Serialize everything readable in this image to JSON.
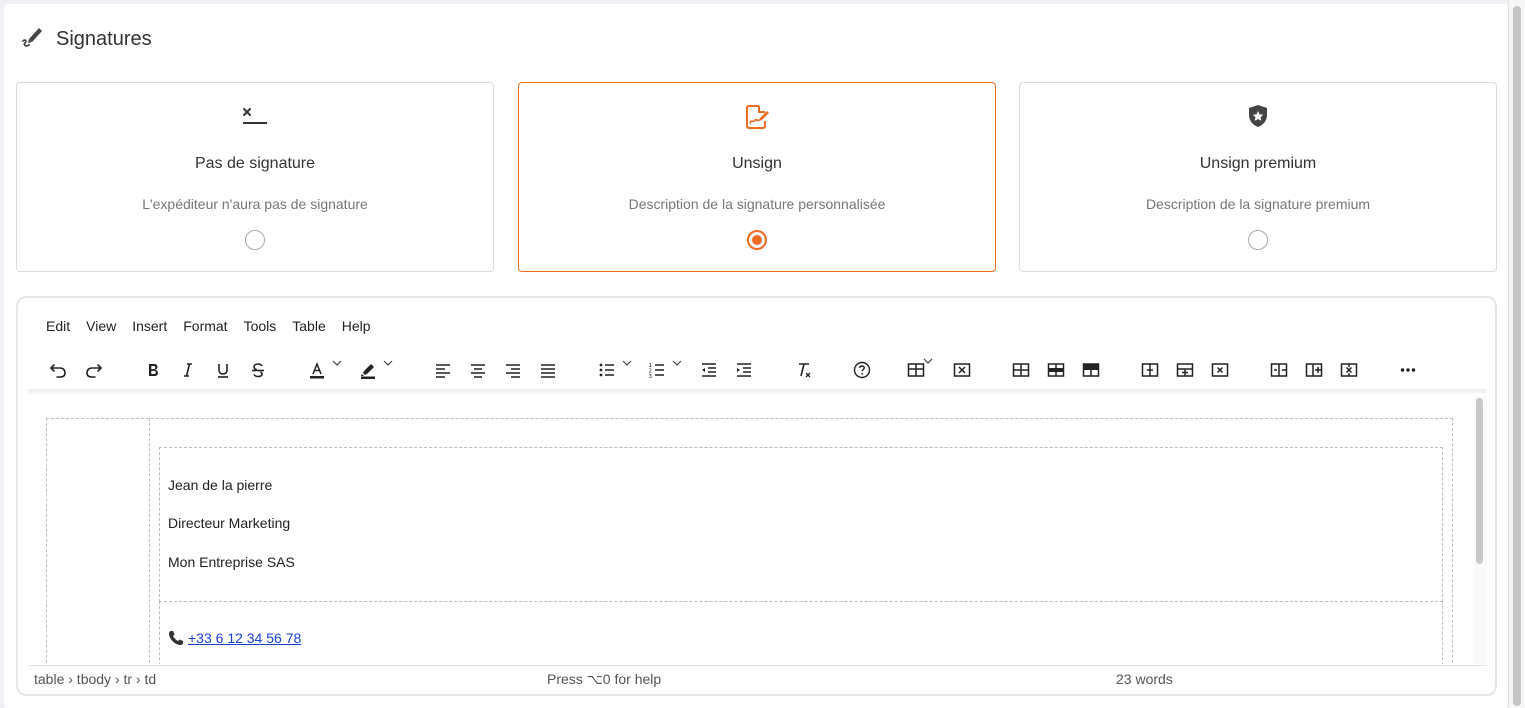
{
  "header": {
    "title": "Signatures",
    "icon": "signature-pen-icon"
  },
  "cards": [
    {
      "title": "Pas de signature",
      "description": "L'expéditeur n'aura pas de signature",
      "icon": "no-signature-icon",
      "selected": false
    },
    {
      "title": "Unsign",
      "description": "Description de la signature personnalisée",
      "icon": "signature-document-icon",
      "selected": true
    },
    {
      "title": "Unsign premium",
      "description": "Description de la signature premium",
      "icon": "shield-star-icon",
      "selected": false
    }
  ],
  "accent_color": "#ec6b23",
  "menubar": [
    "Edit",
    "View",
    "Insert",
    "Format",
    "Tools",
    "Table",
    "Help"
  ],
  "editor": {
    "name": "Jean de la pierre",
    "role": "Directeur Marketing",
    "company": "Mon Entreprise SAS",
    "phone": "+33 6 12 34 56 78",
    "phone_icon": "telephone-icon"
  },
  "statusbar": {
    "path": "table › tbody › tr › td",
    "help": "Press ⌥0 for help",
    "words": "23 words"
  }
}
